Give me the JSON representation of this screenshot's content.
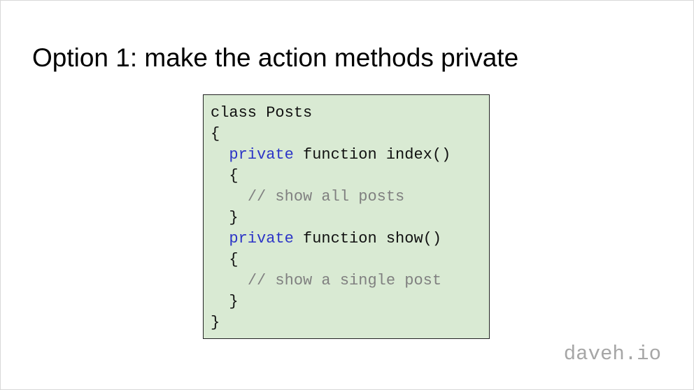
{
  "slide": {
    "title": "Option 1: make the action methods private",
    "brand": "daveh.io"
  },
  "code": {
    "lines": [
      {
        "indent": "",
        "keyword": "",
        "text": "class Posts",
        "comment": ""
      },
      {
        "indent": "",
        "keyword": "",
        "text": "{",
        "comment": ""
      },
      {
        "indent": "  ",
        "keyword": "private",
        "text": " function index()",
        "comment": ""
      },
      {
        "indent": "  ",
        "keyword": "",
        "text": "{",
        "comment": ""
      },
      {
        "indent": "    ",
        "keyword": "",
        "text": "",
        "comment": "// show all posts"
      },
      {
        "indent": "  ",
        "keyword": "",
        "text": "}",
        "comment": ""
      },
      {
        "indent": "  ",
        "keyword": "private",
        "text": " function show()",
        "comment": ""
      },
      {
        "indent": "  ",
        "keyword": "",
        "text": "{",
        "comment": ""
      },
      {
        "indent": "    ",
        "keyword": "",
        "text": "",
        "comment": "// show a single post"
      },
      {
        "indent": "  ",
        "keyword": "",
        "text": "}",
        "comment": ""
      },
      {
        "indent": "",
        "keyword": "",
        "text": "}",
        "comment": ""
      }
    ]
  },
  "colors": {
    "code_background": "#d9ead3",
    "keyword": "#2c35c7",
    "comment": "#808080",
    "brand": "#a6a6a6"
  }
}
